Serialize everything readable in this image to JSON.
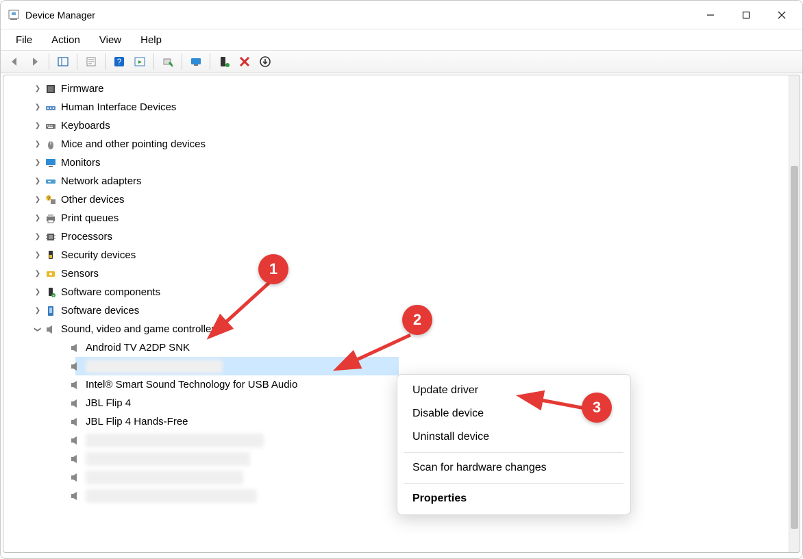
{
  "window": {
    "title": "Device Manager"
  },
  "menubar": {
    "file": "File",
    "action": "Action",
    "view": "View",
    "help": "Help"
  },
  "tree": {
    "firmware": "Firmware",
    "hid": "Human Interface Devices",
    "keyboards": "Keyboards",
    "mice": "Mice and other pointing devices",
    "monitors": "Monitors",
    "network": "Network adapters",
    "other": "Other devices",
    "print": "Print queues",
    "processors": "Processors",
    "security": "Security devices",
    "sensors": "Sensors",
    "swcomp": "Software components",
    "swdev": "Software devices",
    "sound": "Sound, video and game controllers",
    "sound_children": {
      "android": "Android TV A2DP SNK",
      "intel": "Intel® Smart Sound Technology for USB Audio",
      "jbl": "JBL Flip 4",
      "jblhf": "JBL Flip 4 Hands-Free"
    }
  },
  "contextmenu": {
    "update": "Update driver",
    "disable": "Disable device",
    "uninstall": "Uninstall device",
    "scan": "Scan for hardware changes",
    "properties": "Properties"
  },
  "annotations": {
    "b1": "1",
    "b2": "2",
    "b3": "3"
  }
}
